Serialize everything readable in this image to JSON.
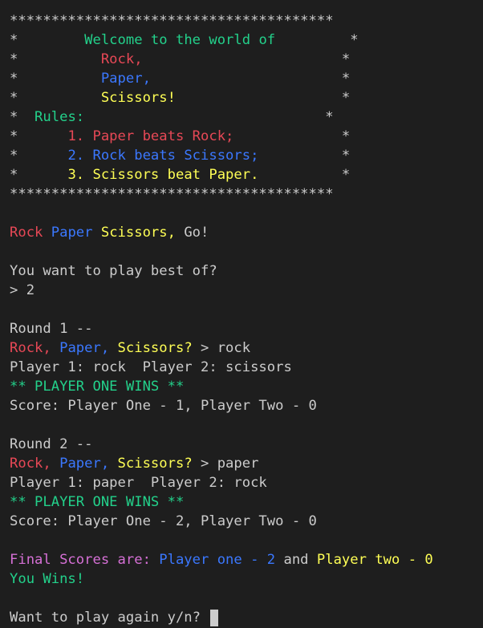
{
  "colors": {
    "background": "#1e1e1e",
    "default": "#cccccc",
    "red": "#e74856",
    "blue": "#3b78ff",
    "yellow": "#f9f1a5",
    "green": "#23d18b",
    "magenta": "#d670d6"
  },
  "lines": [
    [
      {
        "t": "***************************************",
        "c": "white"
      }
    ],
    [
      {
        "t": "*",
        "c": "white"
      },
      {
        "t": "        Welcome to the world of         ",
        "c": "green2"
      },
      {
        "t": "*",
        "c": "white"
      }
    ],
    [
      {
        "t": "*",
        "c": "white"
      },
      {
        "t": "          Rock,",
        "c": "red"
      },
      {
        "t": "                        *",
        "c": "white"
      }
    ],
    [
      {
        "t": "*",
        "c": "white"
      },
      {
        "t": "          Paper,",
        "c": "blue"
      },
      {
        "t": "                       *",
        "c": "white"
      }
    ],
    [
      {
        "t": "*",
        "c": "white"
      },
      {
        "t": "          Scissors!",
        "c": "yellow2"
      },
      {
        "t": "                    *",
        "c": "white"
      }
    ],
    [
      {
        "t": "*",
        "c": "white"
      },
      {
        "t": "  Rules:",
        "c": "green2"
      },
      {
        "t": "                             *",
        "c": "white"
      }
    ],
    [
      {
        "t": "*",
        "c": "white"
      },
      {
        "t": "      1. Paper beats Rock;",
        "c": "red"
      },
      {
        "t": "             *",
        "c": "white"
      }
    ],
    [
      {
        "t": "*",
        "c": "white"
      },
      {
        "t": "      2. Rock beats Scissors;",
        "c": "blue"
      },
      {
        "t": "          *",
        "c": "white"
      }
    ],
    [
      {
        "t": "*",
        "c": "white"
      },
      {
        "t": "      3. Scissors beat Paper.",
        "c": "yellow2"
      },
      {
        "t": "          *",
        "c": "white"
      }
    ],
    [
      {
        "t": "***************************************",
        "c": "white"
      }
    ],
    [],
    [
      {
        "t": "Rock ",
        "c": "red"
      },
      {
        "t": "Paper ",
        "c": "blue"
      },
      {
        "t": "Scissors, ",
        "c": "yellow2"
      },
      {
        "t": "Go!",
        "c": "white"
      }
    ],
    [],
    [
      {
        "t": "You want to play best of?",
        "c": "white"
      }
    ],
    [
      {
        "t": "> 2",
        "c": "white"
      }
    ],
    [],
    [
      {
        "t": "Round 1 --",
        "c": "white"
      }
    ],
    [
      {
        "t": "Rock, ",
        "c": "red"
      },
      {
        "t": "Paper, ",
        "c": "blue"
      },
      {
        "t": "Scissors? ",
        "c": "yellow2"
      },
      {
        "t": "> rock",
        "c": "white"
      }
    ],
    [
      {
        "t": "Player 1: rock  Player 2: scissors",
        "c": "white"
      }
    ],
    [
      {
        "t": "** PLAYER ONE WINS **",
        "c": "green2"
      }
    ],
    [
      {
        "t": "Score: Player One - 1, Player Two - 0",
        "c": "white"
      }
    ],
    [],
    [
      {
        "t": "Round 2 --",
        "c": "white"
      }
    ],
    [
      {
        "t": "Rock, ",
        "c": "red"
      },
      {
        "t": "Paper, ",
        "c": "blue"
      },
      {
        "t": "Scissors? ",
        "c": "yellow2"
      },
      {
        "t": "> paper",
        "c": "white"
      }
    ],
    [
      {
        "t": "Player 1: paper  Player 2: rock",
        "c": "white"
      }
    ],
    [
      {
        "t": "** PLAYER ONE WINS **",
        "c": "green2"
      }
    ],
    [
      {
        "t": "Score: Player One - 2, Player Two - 0",
        "c": "white"
      }
    ],
    [],
    [
      {
        "t": "Final Scores are: ",
        "c": "magenta"
      },
      {
        "t": "Player one - 2 ",
        "c": "blue"
      },
      {
        "t": "and ",
        "c": "white"
      },
      {
        "t": "Player two - 0",
        "c": "yellow2"
      }
    ],
    [
      {
        "t": "You Wins!",
        "c": "green2"
      }
    ],
    [],
    [
      {
        "t": "Want to play again y/n? ",
        "c": "white"
      }
    ]
  ]
}
